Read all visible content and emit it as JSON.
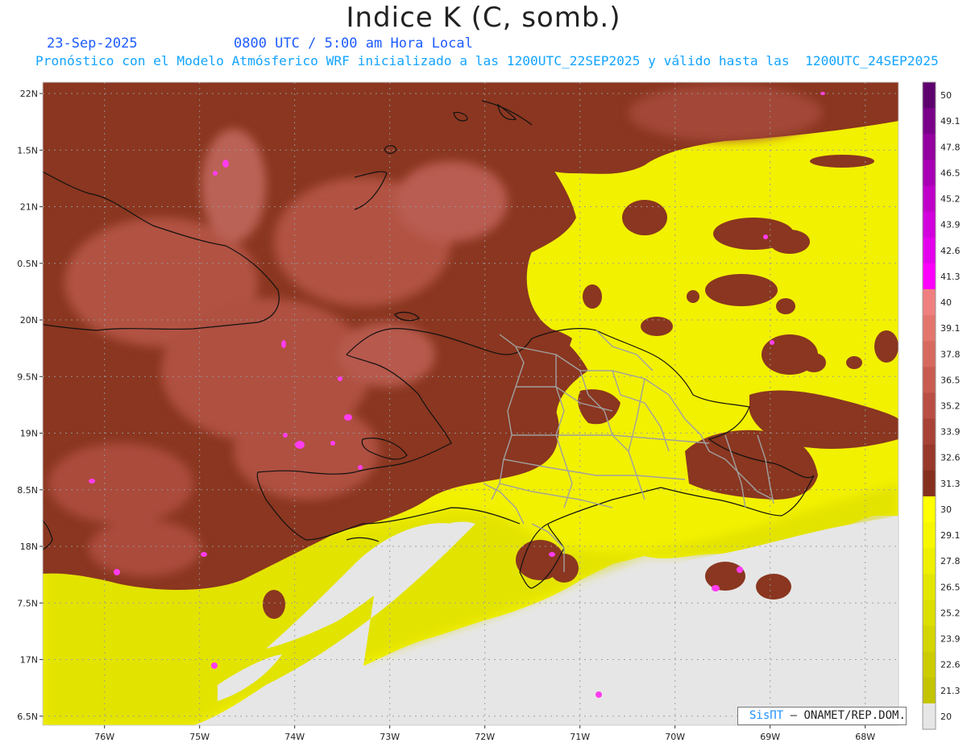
{
  "header": {
    "title": "Indice K (C, somb.)",
    "date": "23-Sep-2025",
    "time": "0800 UTC / 5:00 am Hora Local",
    "model_line": "Pronóstico con el Modelo Atmósferico WRF inicializado a las 1200UTC_22SEP2025 y válido hasta las  1200UTC_24SEP2025"
  },
  "axes": {
    "lat_labels": [
      "22N",
      "1.5N",
      "21N",
      "0.5N",
      "20N",
      "9.5N",
      "19N",
      "8.5N",
      "18N",
      "7.5N",
      "17N",
      "6.5N"
    ],
    "lon_labels": [
      "76W",
      "75W",
      "74W",
      "73W",
      "72W",
      "71W",
      "70W",
      "69W",
      "68W"
    ],
    "lat_values": [
      22,
      21.5,
      21,
      20.5,
      20,
      19.5,
      19,
      18.5,
      18,
      17.5,
      17,
      16.5
    ],
    "lon_values": [
      -76,
      -75,
      -74,
      -73,
      -72,
      -71,
      -70,
      -69,
      -68
    ],
    "extent": {
      "lon_min": -76.65,
      "lon_max": -67.65,
      "lat_min": 16.42,
      "lat_max": 22.1
    },
    "grid": "dotted"
  },
  "legend": {
    "labels": [
      "50",
      "49.1",
      "47.8",
      "46.5",
      "45.2",
      "43.9",
      "42.6",
      "41.3",
      "40",
      "39.1",
      "37.8",
      "36.5",
      "35.2",
      "33.9",
      "32.6",
      "31.3",
      "30",
      "29.1",
      "27.8",
      "26.5",
      "25.2",
      "23.9",
      "22.6",
      "21.3",
      "20"
    ],
    "colors": [
      "#5e006e",
      "#7a008a",
      "#93009f",
      "#a800b4",
      "#bf00c8",
      "#d200dc",
      "#e400ec",
      "#ff00ff",
      "#f08080",
      "#e4766d",
      "#d76a5e",
      "#c85c50",
      "#b94e44",
      "#a84236",
      "#97382a",
      "#85301e",
      "#ffff00",
      "#f7f700",
      "#eef000",
      "#e3e600",
      "#dcde00",
      "#d4d500",
      "#cdcc00",
      "#c4c400",
      "#e6e6e6"
    ]
  },
  "footer": {
    "brand": "SisПT",
    "org": " – ONAMET/REP.DOM."
  }
}
